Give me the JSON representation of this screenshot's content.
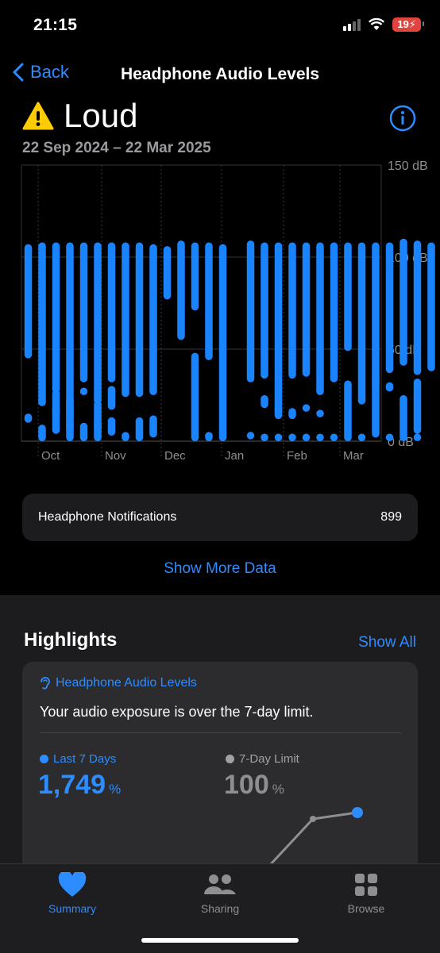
{
  "status": {
    "time": "21:15",
    "battery": "19"
  },
  "nav": {
    "back_label": "Back",
    "title": "Headphone Audio Levels"
  },
  "header": {
    "level": "Loud",
    "date_range": "22 Sep 2024 – 22 Mar 2025"
  },
  "chart_data": {
    "type": "bar",
    "title": "",
    "ylabel": "",
    "y_unit": "dB",
    "ylim": [
      0,
      150
    ],
    "y_ticks": [
      "150 dB",
      "100 dB",
      "50 dB",
      "0 dB"
    ],
    "x_ticks": [
      "Oct",
      "Nov",
      "Dec",
      "Jan",
      "Feb",
      "Mar"
    ],
    "grid": true,
    "color": "#1a84ff",
    "bars": [
      {
        "x": 0,
        "segments": [
          [
            45,
            107
          ],
          [
            10,
            15
          ]
        ]
      },
      {
        "x": 1,
        "segments": [
          [
            19,
            108
          ],
          [
            0,
            9
          ]
        ]
      },
      {
        "x": 2,
        "segments": [
          [
            26,
            108
          ],
          [
            4,
            28
          ],
          [
            13,
            20
          ]
        ]
      },
      {
        "x": 3,
        "segments": [
          [
            11,
            108
          ],
          [
            5,
            25
          ],
          [
            0,
            13
          ]
        ]
      },
      {
        "x": 4,
        "segments": [
          [
            32,
            108
          ],
          [
            25,
            29
          ],
          [
            0,
            10
          ]
        ]
      },
      {
        "x": 5,
        "segments": [
          [
            20,
            108
          ],
          [
            5,
            22
          ],
          [
            0,
            12
          ]
        ]
      },
      {
        "x": 6,
        "segments": [
          [
            32,
            108
          ],
          [
            17,
            30
          ],
          [
            3,
            13
          ]
        ]
      },
      {
        "x": 7,
        "segments": [
          [
            24,
            108
          ],
          [
            0,
            5
          ]
        ]
      },
      {
        "x": 8,
        "segments": [
          [
            24,
            108
          ],
          [
            0,
            13
          ]
        ]
      },
      {
        "x": 9,
        "segments": [
          [
            36,
            107
          ],
          [
            25,
            40
          ],
          [
            2,
            14
          ]
        ]
      },
      {
        "x": 10,
        "segments": [
          [
            77,
            106
          ]
        ]
      },
      {
        "x": 11,
        "segments": [
          [
            55,
            109
          ]
        ]
      },
      {
        "x": 12,
        "segments": [
          [
            71,
            108
          ],
          [
            0,
            48
          ]
        ]
      },
      {
        "x": 13,
        "segments": [
          [
            44,
            108
          ],
          [
            0,
            5
          ]
        ]
      },
      {
        "x": 14,
        "segments": [
          [
            0,
            107
          ]
        ]
      },
      {
        "x": 16,
        "segments": [
          [
            32,
            109
          ],
          [
            1,
            5
          ]
        ]
      },
      {
        "x": 17,
        "segments": [
          [
            34,
            108
          ],
          [
            18,
            25
          ],
          [
            0,
            2
          ]
        ]
      },
      {
        "x": 18,
        "segments": [
          [
            14,
            108
          ],
          [
            12,
            20
          ],
          [
            0,
            2
          ]
        ]
      },
      {
        "x": 19,
        "segments": [
          [
            34,
            108
          ],
          [
            12,
            18
          ],
          [
            0,
            2
          ]
        ]
      },
      {
        "x": 20,
        "segments": [
          [
            35,
            108
          ],
          [
            16,
            19
          ],
          [
            0,
            2
          ]
        ]
      },
      {
        "x": 21,
        "segments": [
          [
            25,
            108
          ],
          [
            13,
            15
          ],
          [
            0,
            2
          ]
        ]
      },
      {
        "x": 22,
        "segments": [
          [
            32,
            108
          ],
          [
            0,
            3
          ]
        ]
      },
      {
        "x": 23,
        "segments": [
          [
            49,
            108
          ],
          [
            0,
            33
          ]
        ]
      },
      {
        "x": 24,
        "segments": [
          [
            20,
            108
          ],
          [
            21,
            20
          ],
          [
            0,
            2
          ]
        ]
      },
      {
        "x": 25,
        "segments": [
          [
            30,
            108
          ],
          [
            2,
            35
          ]
        ]
      },
      {
        "x": 26,
        "segments": [
          [
            37,
            108
          ],
          [
            32,
            27
          ],
          [
            0,
            1
          ]
        ]
      },
      {
        "x": 27,
        "segments": [
          [
            41,
            110
          ],
          [
            0,
            25
          ]
        ]
      },
      {
        "x": 28,
        "segments": [
          [
            36,
            109
          ],
          [
            4,
            34
          ],
          [
            0,
            3
          ]
        ]
      },
      {
        "x": 29,
        "segments": [
          [
            38,
            108
          ]
        ]
      }
    ]
  },
  "notifications": {
    "label": "Headphone Notifications",
    "value": "899"
  },
  "show_more": "Show More Data",
  "highlights": {
    "title": "Highlights",
    "show_all": "Show All",
    "category": "Headphone Audio Levels",
    "message": "Your audio exposure is over the 7-day limit.",
    "legend1": "Last 7 Days",
    "value1": "1,749",
    "unit1": "%",
    "legend2": "7-Day Limit",
    "value2": "100",
    "unit2": "%"
  },
  "tabs": [
    {
      "label": "Summary",
      "icon": "heart-icon",
      "active": true
    },
    {
      "label": "Sharing",
      "icon": "people-icon",
      "active": false
    },
    {
      "label": "Browse",
      "icon": "grid-icon",
      "active": false
    }
  ],
  "colors": {
    "accent": "#2d8cff",
    "warning": "#ffcc00",
    "bar": "#1a84ff"
  }
}
